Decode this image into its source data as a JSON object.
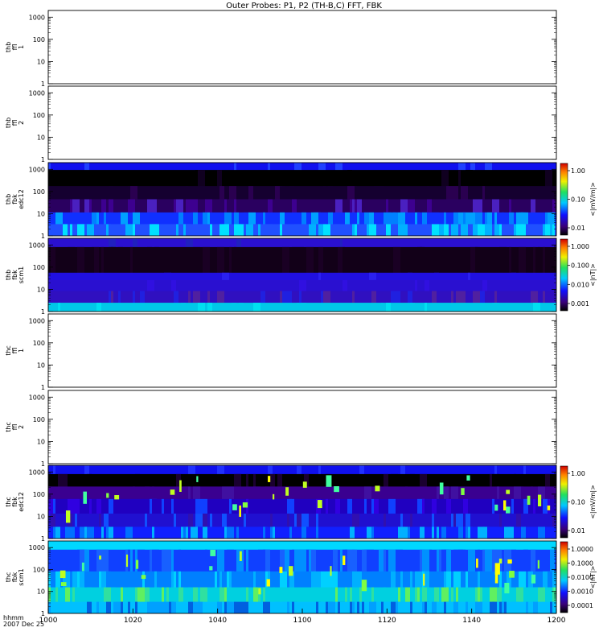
{
  "title": "Outer Probes: P1, P2 (TH-B,C) FFT, FBK",
  "chart_data": {
    "type": "heatmap",
    "x_axis": {
      "ticks": [
        "1000",
        "1020",
        "1040",
        "1100",
        "1120",
        "1140",
        "1200"
      ],
      "row_labels": [
        "hhmm",
        "2007 Dec 25"
      ]
    },
    "y_axis": {
      "scale": "log",
      "range": [
        1,
        2000
      ],
      "ticks": [
        "1",
        "10",
        "100",
        "1000"
      ]
    },
    "panels": [
      {
        "label": [
          "thb",
          "ffl",
          "1"
        ],
        "kind": "empty"
      },
      {
        "label": [
          "thb",
          "ffl",
          "2"
        ],
        "kind": "empty"
      },
      {
        "label": [
          "thb",
          "fbk",
          "edc12"
        ],
        "kind": "spectrogram",
        "colorbar": {
          "label": "<|mV/m|>",
          "ticks": [
            "1.00",
            "0.10",
            "0.01"
          ]
        }
      },
      {
        "label": [
          "thb",
          "fbk",
          "scm1"
        ],
        "kind": "spectrogram",
        "colorbar": {
          "label": "<|nT|>",
          "ticks": [
            "1.000",
            "0.100",
            "0.010",
            "0.001"
          ]
        }
      },
      {
        "label": [
          "thc",
          "ffl",
          "1"
        ],
        "kind": "empty"
      },
      {
        "label": [
          "thc",
          "ffl",
          "2"
        ],
        "kind": "empty"
      },
      {
        "label": [
          "thc",
          "fbk",
          "edc12"
        ],
        "kind": "spectrogram",
        "colorbar": {
          "label": "<|mV/m|>",
          "ticks": [
            "1.00",
            "0.10",
            "0.01"
          ]
        }
      },
      {
        "label": [
          "thc",
          "fbk",
          "scm1"
        ],
        "kind": "spectrogram",
        "colorbar": {
          "label": "<|nT|>",
          "ticks": [
            "1.0000",
            "0.1000",
            "0.0100",
            "0.0010",
            "0.0001"
          ]
        }
      }
    ]
  }
}
